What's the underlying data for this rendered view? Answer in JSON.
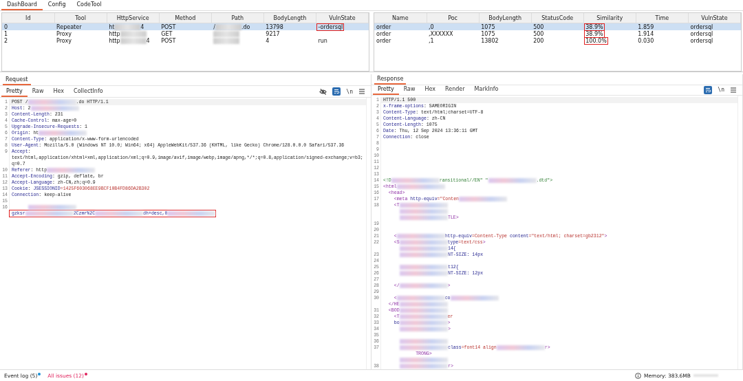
{
  "main_tabs": [
    {
      "label": "DashBoard",
      "selected": true
    },
    {
      "label": "Config",
      "selected": false
    },
    {
      "label": "CodeTool",
      "selected": false
    }
  ],
  "requests_table": {
    "columns": [
      "Id",
      "Tool",
      "HttpService",
      "Method",
      "Path",
      "BodyLength",
      "VulnState"
    ],
    "rows": [
      {
        "selected": true,
        "cells": [
          "0",
          "Repeater",
          [
            {
              "text": "ht"
            },
            {
              "kind": "redacted"
            },
            {
              "text": "4"
            }
          ],
          "POST",
          [
            {
              "text": "/"
            },
            {
              "kind": "redacted"
            },
            {
              "text": ".do"
            }
          ],
          "13798",
          {
            "text": "-ordersql",
            "highlighted": true
          }
        ]
      },
      {
        "selected": false,
        "cells": [
          "1",
          "Proxy",
          [
            {
              "text": "http"
            },
            {
              "kind": "redacted"
            }
          ],
          "GET",
          [
            {
              "kind": "redacted"
            }
          ],
          "9217"
        ]
      },
      {
        "selected": false,
        "cells": [
          "2",
          "Proxy",
          [
            {
              "text": "http"
            },
            {
              "kind": "redacted"
            },
            {
              "text": "4"
            }
          ],
          "POST",
          [
            {
              "kind": "redacted"
            }
          ],
          "4",
          "run"
        ]
      }
    ]
  },
  "results_table": {
    "columns": [
      "Name",
      "Poc",
      "BodyLength",
      "StatusCode",
      "Similarity",
      "Time",
      "VulnState"
    ],
    "rows": [
      {
        "selected": true,
        "cells": [
          "order",
          ",0",
          "1075",
          "500",
          {
            "text": "38.9%",
            "highlighted": true
          },
          "1.859",
          "ordersql"
        ]
      },
      {
        "selected": false,
        "cells": [
          "order",
          ",XXXXXX",
          "1075",
          "500",
          {
            "text": "38.9%",
            "highlighted": true
          },
          "1.914",
          "ordersql"
        ]
      },
      {
        "selected": false,
        "cells": [
          "order",
          ",1",
          "13802",
          "200",
          {
            "text": "100.0%",
            "highlighted": true
          },
          "0.030",
          "ordersql"
        ]
      }
    ]
  },
  "request": {
    "title": "Request",
    "tabs": [
      {
        "label": "Pretty",
        "selected": true
      },
      {
        "label": "Raw",
        "selected": false
      },
      {
        "label": "Hex",
        "selected": false
      },
      {
        "label": "CollectInfo",
        "selected": false
      }
    ],
    "tools": [
      {
        "kind": "hide"
      },
      {
        "kind": "wrap",
        "on": true
      },
      {
        "kind": "newline",
        "label": "\\n"
      },
      {
        "kind": "menu"
      }
    ],
    "lines": [
      {
        "num": "1",
        "parts": [
          {
            "text": "POST /"
          },
          {
            "kind": "redacted"
          },
          {
            "text": ".do HTTP/1.1"
          }
        ]
      },
      {
        "num": "2",
        "parts": [
          {
            "text": "Host",
            "kind": "key"
          },
          {
            "text": ": 2"
          },
          {
            "kind": "redacted"
          }
        ]
      },
      {
        "num": "3",
        "parts": [
          {
            "text": "Content-Length",
            "kind": "key"
          },
          {
            "text": ": 231"
          }
        ]
      },
      {
        "num": "4",
        "parts": [
          {
            "text": "Cache-Control",
            "kind": "key"
          },
          {
            "text": ": max-age=0"
          }
        ]
      },
      {
        "num": "5",
        "parts": [
          {
            "text": "Upgrade-Insecure-Requests",
            "kind": "key"
          },
          {
            "text": ": 1"
          }
        ]
      },
      {
        "num": "6",
        "parts": [
          {
            "text": "Origin",
            "kind": "key"
          },
          {
            "text": ": ht"
          },
          {
            "kind": "redacted"
          }
        ]
      },
      {
        "num": "7",
        "parts": [
          {
            "text": "Content-Type",
            "kind": "key"
          },
          {
            "text": ": application/x-www-form-urlencoded"
          }
        ]
      },
      {
        "num": "8",
        "parts": [
          {
            "text": "User-Agent",
            "kind": "key"
          },
          {
            "text": ": Mozilla/5.0 (Windows NT 10.0; Win64; x64) AppleWebKit/537.36 (KHTML, like Gecko) Chrome/128.0.0.0 Safari/537.36"
          }
        ]
      },
      {
        "num": "9",
        "parts": [
          {
            "text": "Accept",
            "kind": "key"
          },
          {
            "text": ":"
          }
        ]
      },
      {
        "parts": [
          {
            "text": "text/html,application/xhtml+xml,application/xml;q=0.9,image/avif,image/webp,image/apng,*/*;q=0.8,application/signed-exchange;v=b3;"
          }
        ]
      },
      {
        "parts": [
          {
            "text": "q=0.7"
          }
        ]
      },
      {
        "num": "10",
        "parts": [
          {
            "text": "Referer",
            "kind": "key"
          },
          {
            "text": ": http"
          },
          {
            "kind": "redacted"
          }
        ]
      },
      {
        "num": "11",
        "parts": [
          {
            "text": "Accept-Encoding",
            "kind": "key"
          },
          {
            "text": ": gzip, deflate, br"
          }
        ]
      },
      {
        "num": "12",
        "parts": [
          {
            "text": "Accept-Language",
            "kind": "key"
          },
          {
            "text": ": zh-CN,zh;q=0.9"
          }
        ]
      },
      {
        "num": "13",
        "parts": [
          {
            "text": "Cookie",
            "kind": "key"
          },
          {
            "text": ": "
          },
          {
            "text": "JSESSIONID",
            "kind": "key"
          },
          {
            "text": "=1425F603068EE9BCF10B4FD86DA2B302",
            "kind": "string"
          }
        ]
      },
      {
        "num": "14",
        "parts": [
          {
            "text": "Connection",
            "kind": "key"
          },
          {
            "text": ": keep-alive"
          }
        ]
      },
      {
        "num": "15"
      },
      {
        "num": "16",
        "parts": [
          {
            "kind": "redacted"
          }
        ]
      },
      {
        "highlighted": true,
        "parts": [
          {
            "text": "gzksr",
            "kind": "key"
          },
          {
            "kind": "redacted"
          },
          {
            "text": "2Czmr%2C",
            "kind": "key"
          },
          {
            "kind": "redacted"
          },
          {
            "text": "dh+desc,0",
            "kind": "key"
          },
          {
            "kind": "redacted"
          }
        ]
      }
    ]
  },
  "response": {
    "title": "Response",
    "tabs": [
      {
        "label": "Pretty",
        "selected": true
      },
      {
        "label": "Raw",
        "selected": false
      },
      {
        "label": "Hex",
        "selected": false
      },
      {
        "label": "Render",
        "selected": false
      },
      {
        "label": "MarkInfo",
        "selected": false
      }
    ],
    "tools": [
      {
        "kind": "wrap",
        "on": true
      },
      {
        "kind": "newline",
        "label": "\\n"
      },
      {
        "kind": "menu"
      }
    ],
    "lines": [
      {
        "num": "1",
        "parts": [
          {
            "text": "HTTP/1.1 500"
          }
        ]
      },
      {
        "num": "2",
        "parts": [
          {
            "text": "x-frame-options",
            "kind": "key"
          },
          {
            "text": ": SAMEORIGIN"
          }
        ]
      },
      {
        "num": "3",
        "parts": [
          {
            "text": "Content-Type",
            "kind": "key"
          },
          {
            "text": ": text/html;charset=UTF-8"
          }
        ]
      },
      {
        "num": "4",
        "parts": [
          {
            "text": "Content-Language",
            "kind": "key"
          },
          {
            "text": ": zh-CN"
          }
        ]
      },
      {
        "num": "5",
        "parts": [
          {
            "text": "Content-Length",
            "kind": "key"
          },
          {
            "text": ": 1075"
          }
        ]
      },
      {
        "num": "6",
        "parts": [
          {
            "text": "Date",
            "kind": "key"
          },
          {
            "text": ": Thu, 12 Sep 2024 13:36:11 GMT"
          }
        ]
      },
      {
        "num": "7",
        "parts": [
          {
            "text": "Connection",
            "kind": "key"
          },
          {
            "text": ": close"
          }
        ]
      },
      {
        "num": "8"
      },
      {
        "num": "9"
      },
      {
        "num": "10"
      },
      {
        "num": "11"
      },
      {
        "num": "12"
      },
      {
        "num": "13"
      },
      {
        "num": "14",
        "parts": [
          {
            "text": "<!D",
            "kind": "doctype"
          },
          {
            "kind": "redacted"
          },
          {
            "text": "ransitional//EN\" \"",
            "kind": "doctype"
          },
          {
            "kind": "redacted"
          },
          {
            "text": ".dtd\">",
            "kind": "doctype"
          }
        ]
      },
      {
        "num": "15",
        "parts": [
          {
            "text": "<html",
            "kind": "tag"
          },
          {
            "kind": "redacted"
          }
        ]
      },
      {
        "num": "16",
        "parts": [
          {
            "text": "  <head>",
            "kind": "tag"
          }
        ]
      },
      {
        "num": "17",
        "parts": [
          {
            "text": "    <meta",
            "kind": "tag"
          },
          {
            "text": " http-equiv",
            "kind": "key"
          },
          {
            "text": "=\"Conten",
            "kind": "string"
          },
          {
            "kind": "redacted"
          }
        ]
      },
      {
        "num": "18",
        "parts": [
          {
            "text": "    <T",
            "kind": "tag"
          },
          {
            "kind": "redacted"
          }
        ]
      },
      {
        "parts": [
          {
            "kind": "redacted"
          }
        ]
      },
      {
        "parts": [
          {
            "kind": "redacted"
          },
          {
            "text": "TLE>",
            "kind": "tag"
          }
        ]
      },
      {
        "num": "19"
      },
      {
        "num": "20"
      },
      {
        "num": "21",
        "parts": [
          {
            "text": "    <",
            "kind": "tag"
          },
          {
            "kind": "redacted"
          },
          {
            "text": "http-equiv",
            "kind": "key"
          },
          {
            "text": "=Content-Type ",
            "kind": "string"
          },
          {
            "text": "content",
            "kind": "key"
          },
          {
            "text": "=\"text/html; charset=gb2312\"",
            "kind": "string"
          },
          {
            "text": ">",
            "kind": "tag"
          }
        ]
      },
      {
        "num": "22",
        "parts": [
          {
            "text": "    <S",
            "kind": "tag"
          },
          {
            "kind": "redacted"
          },
          {
            "text": "type",
            "kind": "key"
          },
          {
            "text": "=text/css",
            "kind": "string"
          },
          {
            "text": ">",
            "kind": "tag"
          }
        ]
      },
      {
        "parts": [
          {
            "kind": "redacted"
          },
          {
            "text": "14{",
            "kind": "key"
          }
        ]
      },
      {
        "num": "23",
        "parts": [
          {
            "kind": "redacted"
          },
          {
            "text": "NT-SIZE",
            "kind": "key"
          },
          {
            "text": ": 14px",
            "kind": "key"
          }
        ]
      },
      {
        "num": "24"
      },
      {
        "num": "25",
        "parts": [
          {
            "kind": "redacted"
          },
          {
            "text": "t12{",
            "kind": "key"
          }
        ]
      },
      {
        "num": "26",
        "parts": [
          {
            "kind": "redacted"
          },
          {
            "text": "NT-SIZE",
            "kind": "key"
          },
          {
            "text": ": 12px",
            "kind": "key"
          }
        ]
      },
      {
        "num": "27"
      },
      {
        "num": "28",
        "parts": [
          {
            "text": "    </",
            "kind": "tag"
          },
          {
            "kind": "redacted"
          },
          {
            "text": ">",
            "kind": "tag"
          }
        ]
      },
      {
        "num": "29"
      },
      {
        "num": "30",
        "parts": [
          {
            "text": "    <",
            "kind": "tag"
          },
          {
            "kind": "redacted"
          },
          {
            "text": "co",
            "kind": "key"
          },
          {
            "kind": "redacted"
          }
        ]
      },
      {
        "parts": [
          {
            "text": "  </HE",
            "kind": "tag"
          },
          {
            "kind": "redacted"
          }
        ]
      },
      {
        "num": "31",
        "parts": [
          {
            "text": "  <BOD",
            "kind": "tag"
          },
          {
            "kind": "redacted"
          }
        ]
      },
      {
        "num": "32",
        "parts": [
          {
            "text": "    <T",
            "kind": "tag"
          },
          {
            "kind": "redacted"
          },
          {
            "text": "er",
            "kind": "string"
          }
        ]
      },
      {
        "num": "33",
        "parts": [
          {
            "text": "    bo",
            "kind": "key"
          },
          {
            "kind": "redacted"
          },
          {
            "text": ">",
            "kind": "tag"
          }
        ]
      },
      {
        "num": "34",
        "parts": [
          {
            "kind": "redacted"
          },
          {
            "text": ">",
            "kind": "tag"
          }
        ]
      },
      {
        "num": "35"
      },
      {
        "num": "36",
        "parts": [
          {
            "kind": "redacted"
          }
        ]
      },
      {
        "num": "37",
        "parts": [
          {
            "kind": "redacted"
          },
          {
            "text": "class",
            "kind": "key"
          },
          {
            "text": "=font14 align",
            "kind": "string"
          },
          {
            "kind": "redacted"
          },
          {
            "text": "r>",
            "kind": "tag"
          }
        ]
      },
      {
        "parts": [
          {
            "text": "            TRONG>",
            "kind": "tag"
          }
        ]
      },
      {
        "parts": [
          {
            "kind": "redacted"
          }
        ]
      },
      {
        "num": "38",
        "parts": [
          {
            "kind": "redacted"
          },
          {
            "text": "r>",
            "kind": "tag"
          }
        ]
      }
    ]
  },
  "status_bar": {
    "event_log": {
      "label": "Event log (5)",
      "color": "#1a8fd6"
    },
    "issues": {
      "label": "All issues (12)",
      "color": "#e0245e"
    },
    "memory": "Memory: 383.6MB"
  }
}
